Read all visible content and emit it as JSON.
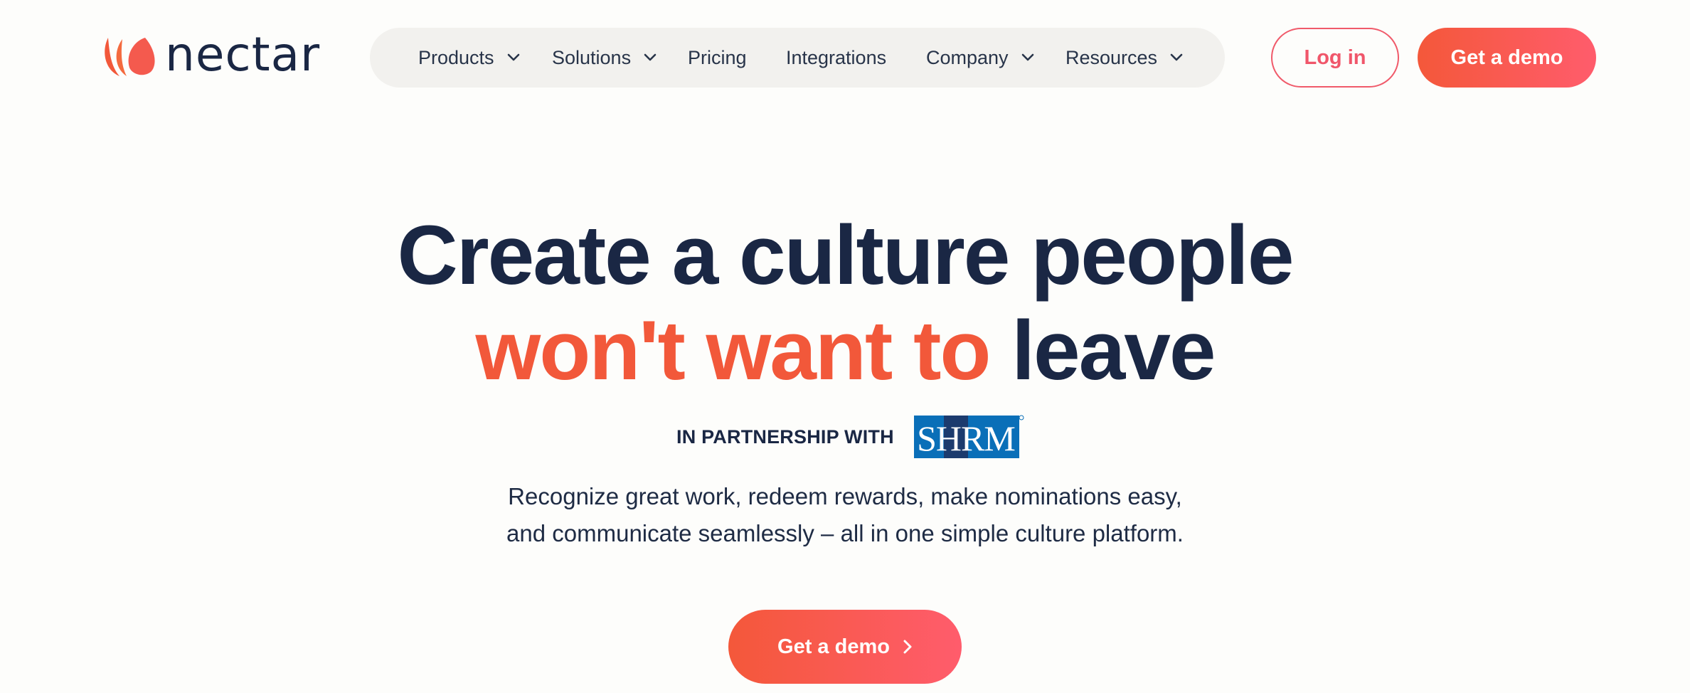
{
  "brand": {
    "name": "nectar",
    "accent_color": "#F2583A",
    "text_color": "#1A2744"
  },
  "nav": {
    "items": [
      {
        "label": "Products",
        "has_dropdown": true
      },
      {
        "label": "Solutions",
        "has_dropdown": true
      },
      {
        "label": "Pricing",
        "has_dropdown": false
      },
      {
        "label": "Integrations",
        "has_dropdown": false
      },
      {
        "label": "Company",
        "has_dropdown": true
      },
      {
        "label": "Resources",
        "has_dropdown": true
      }
    ]
  },
  "header": {
    "login_label": "Log in",
    "demo_label": "Get a demo"
  },
  "hero": {
    "headline_line1": "Create a culture people",
    "headline_accent": "won't want to",
    "headline_end": "leave",
    "partner_label": "IN PARTNERSHIP WITH",
    "partner_logo_text": "SHRM",
    "subtitle_line1": "Recognize great work, redeem rewards, make nominations easy,",
    "subtitle_line2": "and communicate seamlessly – all in one simple culture platform.",
    "cta_label": "Get a demo"
  }
}
